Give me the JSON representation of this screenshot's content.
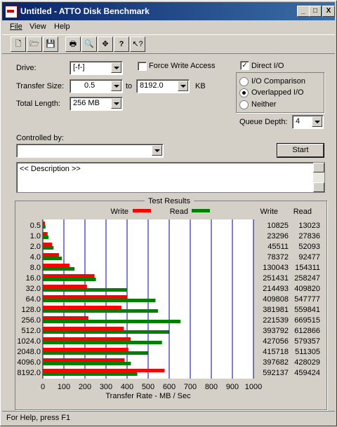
{
  "window": {
    "title": "Untitled - ATTO Disk Benchmark",
    "min": "_",
    "max": "□",
    "close": "X"
  },
  "menu": {
    "file": "File",
    "view": "View",
    "help": "Help"
  },
  "toolbar": {
    "new": "new-icon",
    "open": "open-icon",
    "save": "save-icon",
    "print": "print-icon",
    "preview": "print-preview-icon",
    "move": "move-icon",
    "about": "?",
    "context_help": "context-help-icon"
  },
  "form": {
    "drive_label": "Drive:",
    "drive_value": "[-f-]",
    "force_write_label": "Force Write Access",
    "direct_io_label": "Direct I/O",
    "transfer_size_label": "Transfer Size:",
    "transfer_from": "0.5",
    "to_label": "to",
    "transfer_to": "8192.0",
    "kb_label": "KB",
    "total_length_label": "Total Length:",
    "total_length_value": "256 MB",
    "io_comparison_label": "I/O Comparison",
    "overlapped_label": "Overlapped I/O",
    "neither_label": "Neither",
    "queue_depth_label": "Queue Depth:",
    "queue_depth_value": "4",
    "controlled_by_label": "Controlled by:",
    "controlled_by_value": "",
    "start_label": "Start",
    "description": "<< Description >>"
  },
  "results": {
    "title": "Test Results",
    "col_write": "Write",
    "col_read": "Read"
  },
  "colors": {
    "write": "#ff0000",
    "read": "#008000",
    "grid": "#0000a0"
  },
  "chart_data": {
    "type": "bar",
    "xlabel": "Transfer Rate - MB / Sec",
    "xlim": [
      0,
      1000
    ],
    "xticks": [
      "0",
      "100",
      "200",
      "300",
      "400",
      "500",
      "600",
      "700",
      "800",
      "900",
      "1000"
    ],
    "categories": [
      "0.5",
      "1.0",
      "2.0",
      "4.0",
      "8.0",
      "16.0",
      "32.0",
      "64.0",
      "128.0",
      "256.0",
      "512.0",
      "1024.0",
      "2048.0",
      "4096.0",
      "8192.0"
    ],
    "series": [
      {
        "name": "Write",
        "values": [
          10825,
          23296,
          45511,
          78372,
          130043,
          251431,
          214493,
          409808,
          381981,
          221539,
          393792,
          427056,
          415718,
          397682,
          592137
        ]
      },
      {
        "name": "Read",
        "values": [
          13023,
          27836,
          52093,
          92477,
          154311,
          258247,
          409820,
          547777,
          559841,
          669515,
          612866,
          579357,
          511305,
          428029,
          459424
        ]
      }
    ]
  },
  "status": "For Help, press F1"
}
